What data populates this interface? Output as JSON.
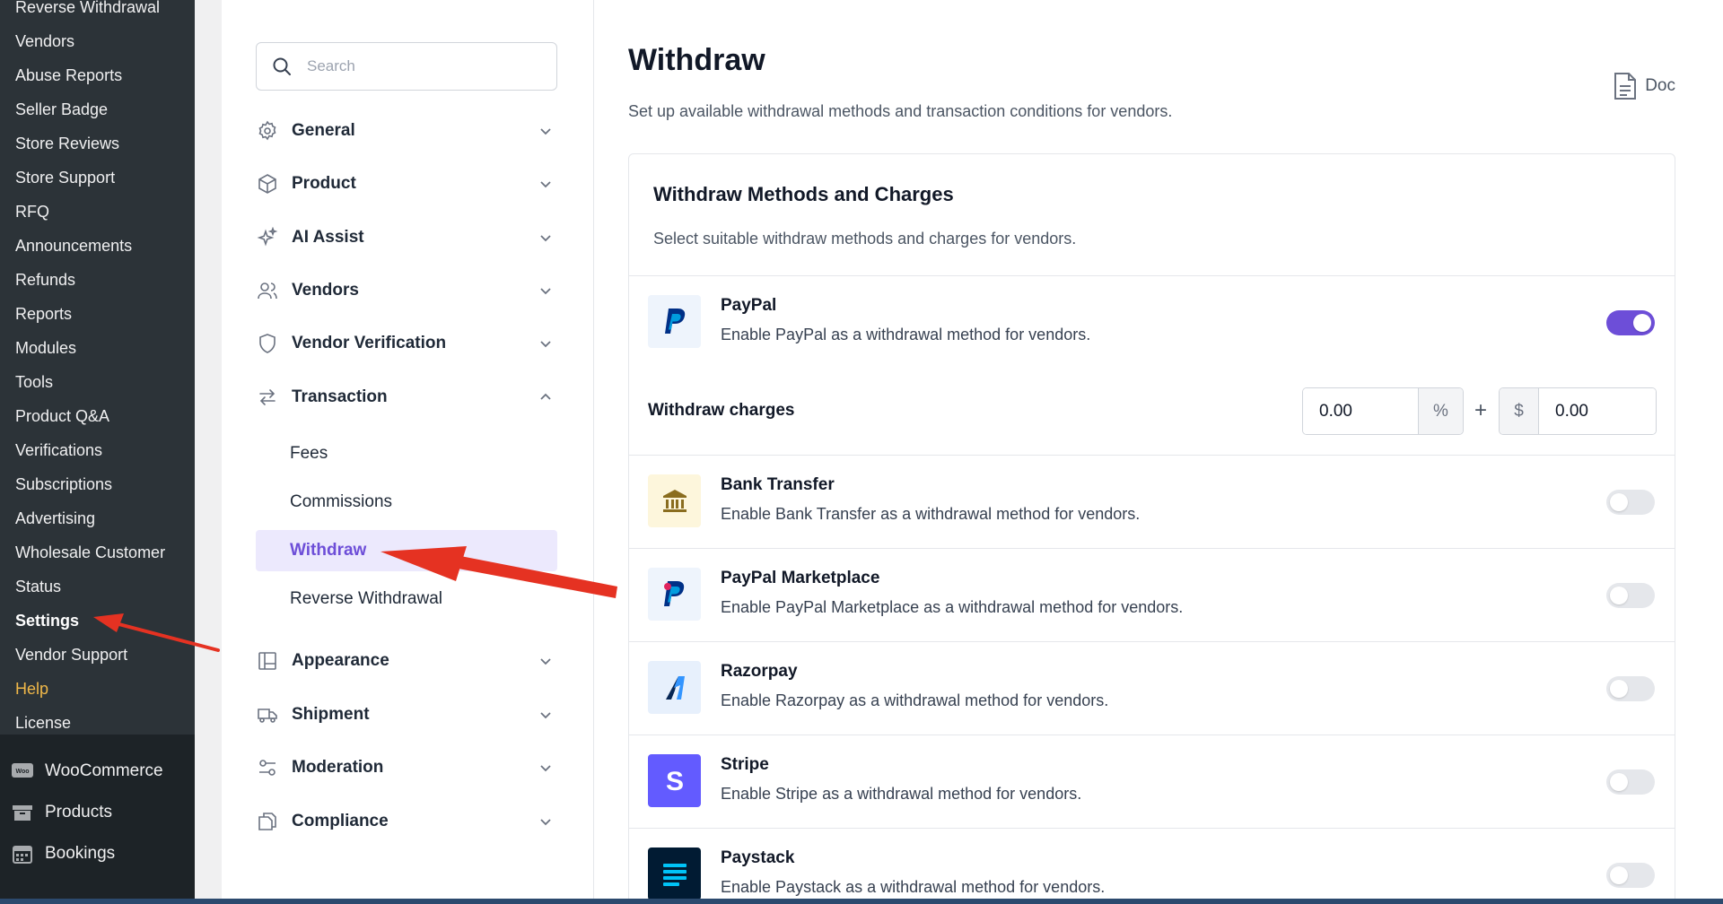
{
  "wp_menu": {
    "sub_items": [
      {
        "label": "Reverse Withdrawal"
      },
      {
        "label": "Vendors"
      },
      {
        "label": "Abuse Reports"
      },
      {
        "label": "Seller Badge"
      },
      {
        "label": "Store Reviews"
      },
      {
        "label": "Store Support"
      },
      {
        "label": "RFQ"
      },
      {
        "label": "Announcements"
      },
      {
        "label": "Refunds"
      },
      {
        "label": "Reports"
      },
      {
        "label": "Modules"
      },
      {
        "label": "Tools"
      },
      {
        "label": "Product Q&A"
      },
      {
        "label": "Verifications"
      },
      {
        "label": "Subscriptions"
      },
      {
        "label": "Advertising"
      },
      {
        "label": "Wholesale Customer"
      },
      {
        "label": "Status"
      },
      {
        "label": "Settings"
      },
      {
        "label": "Vendor Support"
      },
      {
        "label": "Help"
      },
      {
        "label": "License"
      }
    ],
    "top_items": [
      {
        "label": "WooCommerce",
        "icon": "woocommerce-icon"
      },
      {
        "label": "Products",
        "icon": "products-icon"
      },
      {
        "label": "Bookings",
        "icon": "calendar-icon"
      }
    ],
    "current": "Settings"
  },
  "settings_nav": {
    "search_placeholder": "Search",
    "sections": {
      "general": "General",
      "product": "Product",
      "ai_assist": "AI Assist",
      "vendors": "Vendors",
      "vendor_verification": "Vendor Verification",
      "transaction": "Transaction",
      "appearance": "Appearance",
      "shipment": "Shipment",
      "moderation": "Moderation",
      "compliance": "Compliance"
    },
    "transaction_sub": {
      "fees": "Fees",
      "commissions": "Commissions",
      "withdraw": "Withdraw",
      "reverse_withdrawal": "Reverse Withdrawal"
    },
    "active": "Withdraw"
  },
  "page": {
    "title": "Withdraw",
    "description": "Set up available withdrawal methods and transaction conditions for vendors.",
    "doc_label": "Doc"
  },
  "methods_card": {
    "title": "Withdraw Methods and Charges",
    "subtitle": "Select suitable withdraw methods and charges for vendors.",
    "charges_label": "Withdraw charges",
    "percent_value": "0.00",
    "percent_symbol": "%",
    "plus_symbol": "+",
    "currency_symbol": "$",
    "flat_value": "0.00",
    "methods": [
      {
        "name": "PayPal",
        "description": "Enable PayPal as a withdrawal method for vendors.",
        "enabled": true
      },
      {
        "name": "Bank Transfer",
        "description": "Enable Bank Transfer as a withdrawal method for vendors.",
        "enabled": false
      },
      {
        "name": "PayPal Marketplace",
        "description": "Enable PayPal Marketplace as a withdrawal method for vendors.",
        "enabled": false
      },
      {
        "name": "Razorpay",
        "description": "Enable Razorpay as a withdrawal method for vendors.",
        "enabled": false
      },
      {
        "name": "Stripe",
        "description": "Enable Stripe as a withdrawal method for vendors.",
        "enabled": false
      },
      {
        "name": "Paystack",
        "description": "Enable Paystack as a withdrawal method for vendors.",
        "enabled": false
      }
    ]
  },
  "colors": {
    "accent": "#6d4ed8",
    "active_bg": "#ece9fd",
    "wp_sidebar": "#2c3338",
    "annotation_red": "#e53222"
  }
}
